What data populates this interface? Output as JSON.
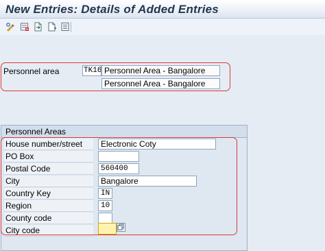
{
  "window": {
    "title": "New Entries: Details of Added Entries"
  },
  "toolbar": {
    "icons": [
      "change-display-icon",
      "delete-icon",
      "copy-entry-icon",
      "previous-entry-icon",
      "select-all-icon"
    ]
  },
  "personnel": {
    "label": "Personnel area",
    "code": "TK16",
    "name": "Personnel Area - Bangalore",
    "name2": "Personnel Area - Bangalore"
  },
  "group": {
    "title": "Personnel Areas",
    "fields": {
      "house": {
        "label": "House number/street",
        "value": "Electronic Coty"
      },
      "pobox": {
        "label": "PO Box",
        "value": ""
      },
      "postal": {
        "label": "Postal Code",
        "value": "560400"
      },
      "city": {
        "label": "City",
        "value": "Bangalore"
      },
      "country": {
        "label": "Country Key",
        "value": "IN"
      },
      "region": {
        "label": "Region",
        "value": "10"
      },
      "county": {
        "label": "County code",
        "value": ""
      },
      "citycode": {
        "label": "City code",
        "value": ""
      }
    }
  },
  "colors": {
    "highlight": "#d63a3a",
    "title": "#23364f",
    "active_field": "#fff3b0"
  }
}
